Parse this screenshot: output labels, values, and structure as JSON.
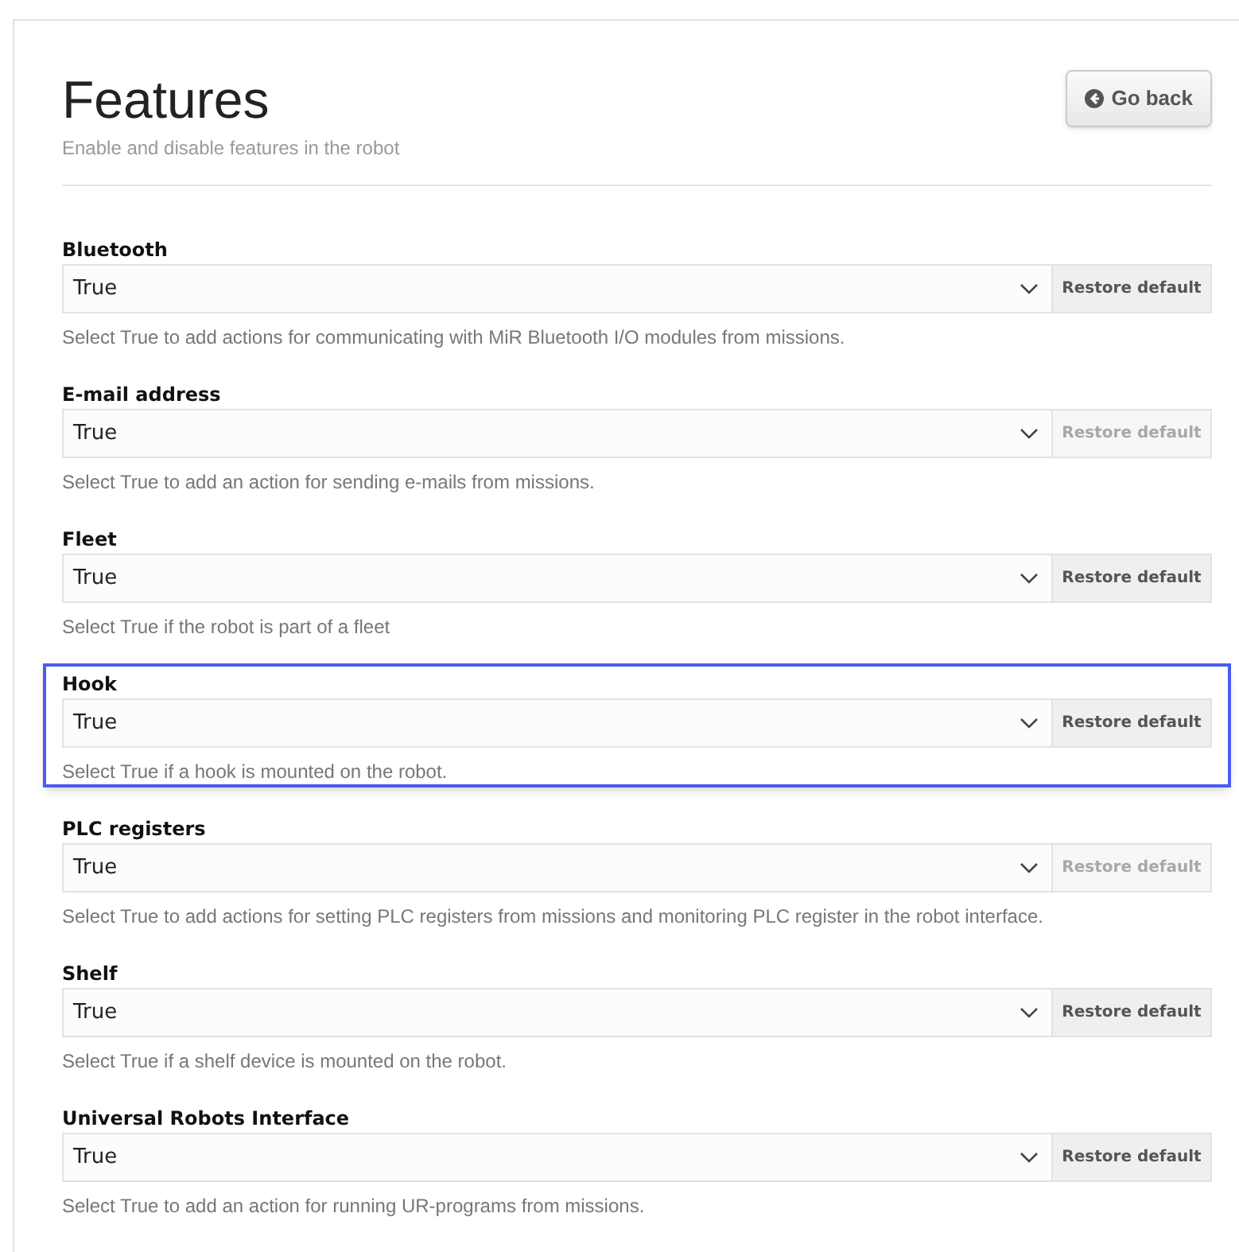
{
  "header": {
    "title": "Features",
    "subtitle": "Enable and disable features in the robot",
    "back_button": "Go back"
  },
  "features": [
    {
      "label": "Bluetooth",
      "value": "True",
      "restore": "Restore default",
      "restore_disabled": false,
      "highlighted": false,
      "help": "Select True to add actions for communicating with MiR Bluetooth I/O modules from missions."
    },
    {
      "label": "E-mail address",
      "value": "True",
      "restore": "Restore default",
      "restore_disabled": true,
      "highlighted": false,
      "help": "Select True to add an action for sending e-mails from missions."
    },
    {
      "label": "Fleet",
      "value": "True",
      "restore": "Restore default",
      "restore_disabled": false,
      "highlighted": false,
      "help": "Select True if the robot is part of a fleet"
    },
    {
      "label": "Hook",
      "value": "True",
      "restore": "Restore default",
      "restore_disabled": false,
      "highlighted": true,
      "help": "Select True if a hook is mounted on the robot."
    },
    {
      "label": "PLC registers",
      "value": "True",
      "restore": "Restore default",
      "restore_disabled": true,
      "highlighted": false,
      "help": "Select True to add actions for setting PLC registers from missions and monitoring PLC register in the robot interface."
    },
    {
      "label": "Shelf",
      "value": "True",
      "restore": "Restore default",
      "restore_disabled": false,
      "highlighted": false,
      "help": "Select True if a shelf device is mounted on the robot."
    },
    {
      "label": "Universal Robots Interface",
      "value": "True",
      "restore": "Restore default",
      "restore_disabled": false,
      "highlighted": false,
      "help": "Select True to add an action for running UR-programs from missions."
    }
  ]
}
